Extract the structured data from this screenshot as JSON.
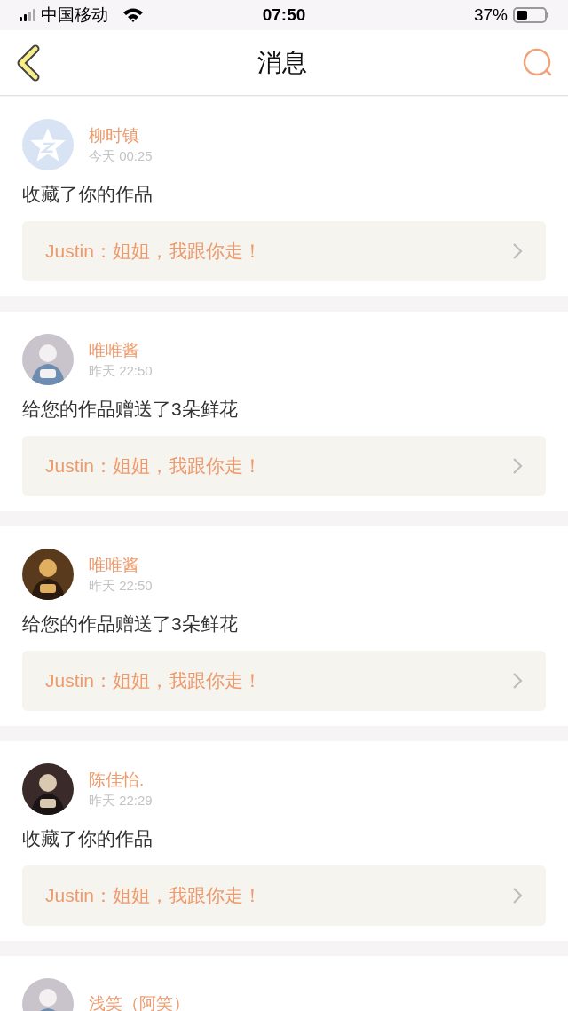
{
  "status_bar": {
    "carrier": "中国移动",
    "time": "07:50",
    "battery": "37%"
  },
  "nav": {
    "title": "消息"
  },
  "messages": [
    {
      "name": "柳时镇",
      "time": "今天 00:25",
      "avatar": {
        "kind": "default"
      },
      "text": "收藏了你的作品",
      "quote": "Justin：姐姐，我跟你走！"
    },
    {
      "name": "唯唯酱",
      "time": "昨天 22:50",
      "text": "给您的作品赠送了3朵鲜花",
      "quote": "Justin：姐姐，我跟你走！"
    },
    {
      "name": "唯唯酱",
      "time": "昨天 22:50",
      "text": "给您的作品赠送了3朵鲜花",
      "quote": "Justin：姐姐，我跟你走！"
    },
    {
      "name": "陈佳怡.",
      "time": "昨天 22:29",
      "text": "收藏了你的作品",
      "quote": "Justin：姐姐，我跟你走！"
    },
    {
      "name": "浅笑（阿笑）"
    }
  ]
}
